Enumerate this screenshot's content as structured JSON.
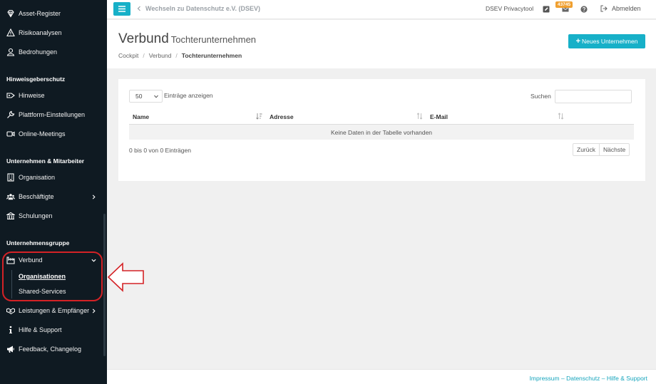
{
  "sidebar": {
    "items_top": [
      {
        "label": "Asset-Register"
      },
      {
        "label": "Risikoanalysen"
      },
      {
        "label": "Bedrohungen"
      }
    ],
    "section_whistle": "Hinweisgeberschutz",
    "items_whistle": [
      {
        "label": "Hinweise"
      },
      {
        "label": "Plattform-Einstellungen"
      },
      {
        "label": "Online-Meetings"
      }
    ],
    "section_company": "Unternehmen & Mitarbeiter",
    "items_company": [
      {
        "label": "Organisation"
      },
      {
        "label": "Beschäftigte"
      },
      {
        "label": "Schulungen"
      }
    ],
    "section_group": "Unternehmensgruppe",
    "verbund": {
      "label": "Verbund"
    },
    "verbund_sub": [
      {
        "label": "Organisationen"
      },
      {
        "label": "Shared-Services"
      }
    ],
    "items_bottom": [
      {
        "label": "Leistungen & Empfänger"
      },
      {
        "label": "Hilfe & Support"
      },
      {
        "label": "Feedback, Changelog"
      }
    ]
  },
  "topbar": {
    "switch_label": "Wechseln zu Datenschutz e.V. (DSEV)",
    "tool_name": "DSEV Privacytool",
    "notification_count": "43745",
    "logout_label": "Abmelden"
  },
  "page": {
    "title": "Verbund",
    "subtitle": "Tochterunternehmen",
    "breadcrumb": [
      "Cockpit",
      "Verbund",
      "Tochterunternehmen"
    ],
    "new_button": "Neues Unternehmen"
  },
  "table": {
    "length_value": "50",
    "length_label": "Einträge anzeigen",
    "search_label": "Suchen",
    "columns": [
      "Name",
      "Adresse",
      "E-Mail"
    ],
    "empty_text": "Keine Daten in der Tabelle vorhanden",
    "info": "0 bis 0 von 0 Einträgen",
    "prev": "Zurück",
    "next": "Nächste"
  },
  "footer": {
    "links": [
      "Impressum",
      "Datenschutz",
      "Hilfe & Support"
    ],
    "separator": "–"
  },
  "colors": {
    "accent": "#17b0c8",
    "sidebar_bg": "#0f1a22",
    "highlight": "#d42226",
    "badge": "#f0a030"
  }
}
